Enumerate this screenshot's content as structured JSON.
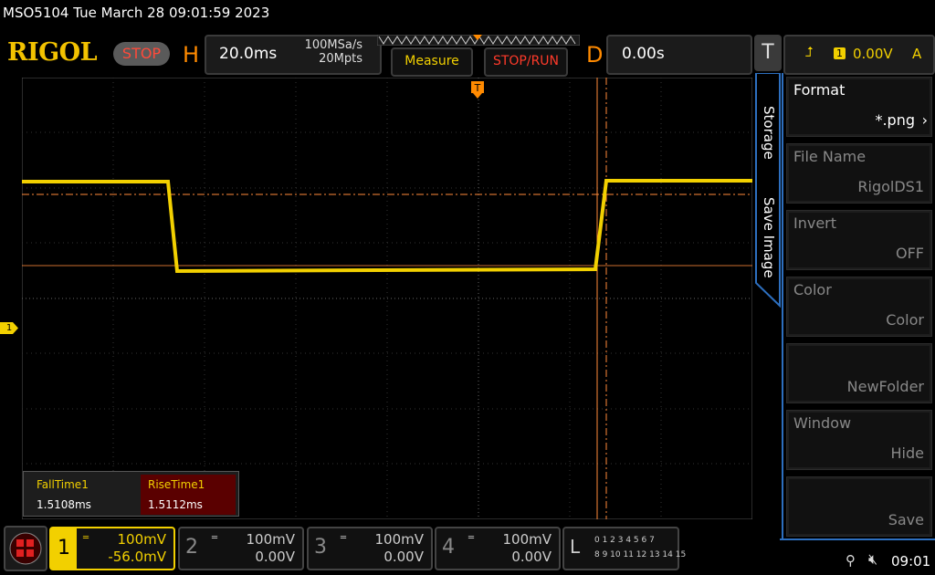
{
  "header": {
    "title": "MSO5104  Tue March 28 09:01:59 2023",
    "logo": "RIGOL",
    "run_state": "STOP"
  },
  "horizontal": {
    "label": "H",
    "timebase": "20.0ms",
    "sample_rate": "100MSa/s",
    "memory_depth": "20Mpts"
  },
  "top_buttons": {
    "measure": "Measure",
    "stop_run": "STOP/RUN"
  },
  "delay": {
    "label": "D",
    "value": "0.00s"
  },
  "trigger": {
    "label": "T",
    "source": "1",
    "level": "0.00V",
    "mode": "A"
  },
  "measurements": [
    {
      "label": "FallTime1",
      "value": "1.5108ms"
    },
    {
      "label": "RiseTime1",
      "value": "1.5112ms"
    }
  ],
  "side_menu": {
    "tabs": [
      "Storage",
      "Save Image"
    ],
    "items": [
      {
        "title": "Format",
        "value": "*.png"
      },
      {
        "title": "File Name",
        "value": "RigolDS1"
      },
      {
        "title": "Invert",
        "value": "OFF"
      },
      {
        "title": "Color",
        "value": "Color"
      },
      {
        "title": "",
        "value": "NewFolder"
      },
      {
        "title": "Window",
        "value": "Hide"
      },
      {
        "title": "",
        "value": "Save"
      }
    ]
  },
  "channels": [
    {
      "num": "1",
      "scale": "100mV",
      "offset": "-56.0mV"
    },
    {
      "num": "2",
      "scale": "100mV",
      "offset": "0.00V"
    },
    {
      "num": "3",
      "scale": "100mV",
      "offset": "0.00V"
    },
    {
      "num": "4",
      "scale": "100mV",
      "offset": "0.00V"
    }
  ],
  "logic": {
    "label": "L",
    "row1": "0 1 2 3   4 5 6 7",
    "row2": "8 9 10 11  12 13 14 15"
  },
  "ch1_marker": "1",
  "status": {
    "time": "09:01"
  },
  "colors": {
    "ch1": "#f2d000",
    "trigger_line": "#ff8a3a",
    "accent_orange": "#ff8a00",
    "menu_border": "#2d6fbf"
  }
}
